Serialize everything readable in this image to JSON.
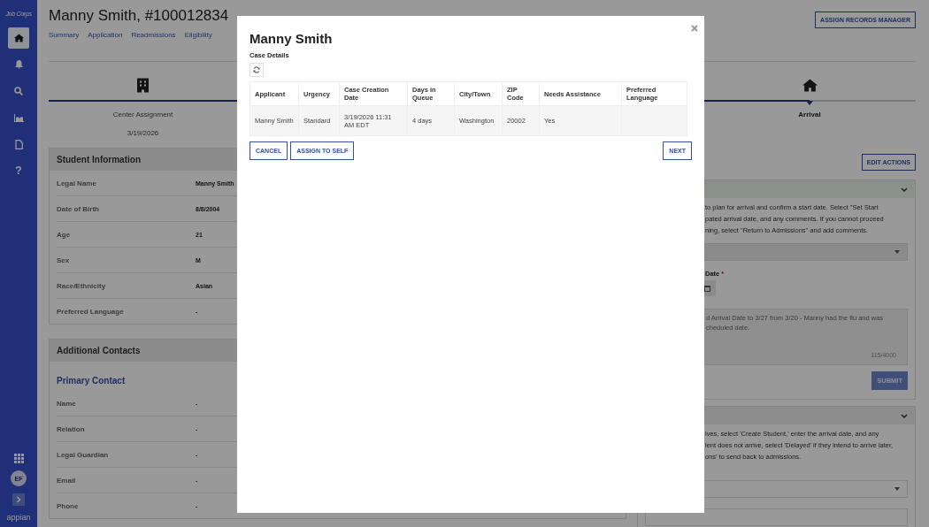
{
  "sidebar": {
    "logo": "Job Corps",
    "nav": [
      {
        "kind": "home",
        "selected": true
      },
      {
        "kind": "bell",
        "selected": false
      },
      {
        "kind": "search",
        "selected": false
      },
      {
        "kind": "chart",
        "selected": false
      },
      {
        "kind": "document",
        "selected": false
      },
      {
        "kind": "help",
        "glyph": "?",
        "selected": false
      }
    ],
    "avatar": "EF",
    "brand": "appian"
  },
  "header": {
    "title": "Manny Smith, #100012834",
    "tabs": [
      "Summary",
      "Application",
      "Readmissions",
      "Eligibility"
    ],
    "action": "ASSIGN RECORDS MANAGER"
  },
  "stepper": [
    {
      "kind": "building",
      "label": "Center Assignment",
      "date": "3/19/2026",
      "current": false
    },
    {
      "kind": "home",
      "label": "Arrival",
      "current": true
    }
  ],
  "student_information": {
    "title": "Student Information",
    "rows": [
      {
        "label": "Legal Name",
        "value": "Manny Smith"
      },
      {
        "label": "Date of Birth",
        "value": "8/8/2004"
      },
      {
        "label": "Age",
        "value": "21"
      },
      {
        "label": "Sex",
        "value": "M"
      },
      {
        "label": "Race/Ethnicity",
        "value": "Asian"
      },
      {
        "label": "Preferred Language",
        "value": "-"
      }
    ]
  },
  "additional_contacts": {
    "title": "Additional Contacts",
    "subtitle": "Primary Contact",
    "rows": [
      {
        "label": "Name",
        "value": "-"
      },
      {
        "label": "Relation",
        "value": "-"
      },
      {
        "label": "Legal Guardian",
        "value": "-"
      },
      {
        "label": "Email",
        "value": "-"
      },
      {
        "label": "Phone",
        "value": "-"
      }
    ]
  },
  "actions": {
    "edit_button": "EDIT ACTIONS",
    "panels": [
      {
        "instructions": "to plan for arrival and confirm a start date. Select \"Set Start\npated arrival date, and any comments. If you cannot proceed\nning, select \"Return to Admissions\" and add comments.",
        "date_label": "Date",
        "required_mark": "*",
        "comment": "d Arrival Date to 3/27 from 3/20 - Manny had the flu and was\ncheduled date.",
        "counter": "115/4000",
        "submit": "SUBMIT"
      },
      {
        "instructions": "ives, select 'Create Student,' enter the arrival date, and any\nlent does not arrive, select 'Delayed' if they intend to arrive later,\nons' to send back to admissions."
      }
    ]
  },
  "modal": {
    "title": "Manny Smith",
    "subtitle": "Case Details",
    "columns": [
      "Applicant",
      "Urgency",
      "Case Creation Date",
      "Days in Queue",
      "City/Town",
      "ZIP Code",
      "Needs Assistance",
      "Preferred Language"
    ],
    "rows": [
      [
        "Manny Smith",
        "Standard",
        "3/19/2026 11:31 AM EDT",
        "4 days",
        "Washington",
        "20002",
        "Yes",
        ""
      ]
    ],
    "buttons": [
      "CANCEL",
      "ASSIGN TO SELF"
    ],
    "next": "NEXT"
  }
}
